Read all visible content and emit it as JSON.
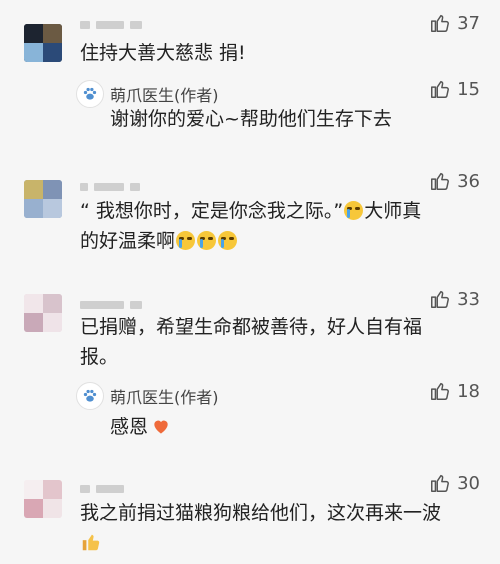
{
  "comments": [
    {
      "likes": "37",
      "text": "住持大善大慈悲 捐!",
      "reply": {
        "author": "萌爪医生(作者)",
        "likes": "15",
        "text": "谢谢你的爱心~帮助他们生存下去"
      }
    },
    {
      "likes": "36",
      "text_line1": "“ 我想你时，定是你念我之际。”",
      "text_line1_suffix": "大师真",
      "text_line2": "的好温柔啊"
    },
    {
      "likes": "33",
      "text_line1": "已捐赠，希望生命都被善待，好人自有福",
      "text_line2": "报。",
      "reply": {
        "author": "萌爪医生(作者)",
        "likes": "18",
        "text": "感恩"
      }
    },
    {
      "likes": "30",
      "text": "我之前捐过猫粮狗粮给他们，这次再来一波"
    }
  ],
  "icons": {
    "like": "thumbs-up-outline-icon",
    "author_avatar": "paw-icon",
    "crying_emoji": "crying-face-emoji",
    "heart_emoji": "orange-heart-emoji",
    "thumbs_emoji": "thumbs-up-emoji"
  },
  "colors": {
    "background": "#f6f6f6",
    "paw": "#4f8fd0",
    "heart": "#ef6a3a"
  }
}
